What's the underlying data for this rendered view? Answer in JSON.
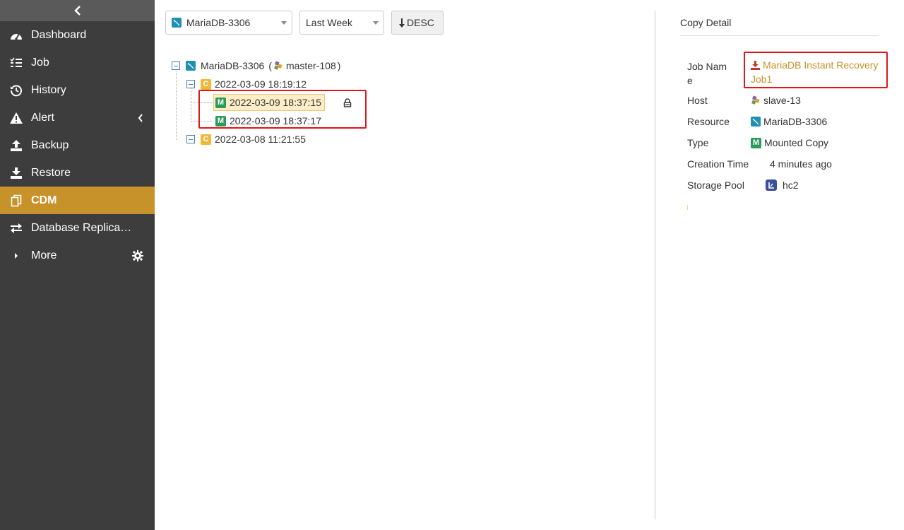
{
  "sidebar": {
    "collapse_icon": "chevron-left-icon",
    "items": [
      {
        "label": "Dashboard",
        "icon": "dashboard-icon"
      },
      {
        "label": "Job",
        "icon": "list-icon"
      },
      {
        "label": "History",
        "icon": "history-icon"
      },
      {
        "label": "Alert",
        "icon": "warning-icon"
      },
      {
        "label": "Backup",
        "icon": "upload-icon"
      },
      {
        "label": "Restore",
        "icon": "download-icon"
      },
      {
        "label": "CDM",
        "icon": "copy-icon"
      },
      {
        "label": "Database Replica…",
        "icon": "exchange-icon"
      },
      {
        "label": "More",
        "icon": "caret-right-icon"
      }
    ],
    "active": "CDM",
    "accent": "#c8922a"
  },
  "toolbar": {
    "resource_select": "MariaDB-3306",
    "range_select": "Last Week",
    "sort_label": "DESC"
  },
  "tree": {
    "root_label": "MariaDB-3306",
    "root_host_open": "(",
    "root_host": "master-108",
    "root_host_close": ")",
    "nodes": [
      {
        "badge": "C",
        "label": "2022-03-09 18:19:12"
      },
      {
        "badge": "M",
        "label": "2022-03-09 18:37:15"
      },
      {
        "badge": "M",
        "label": "2022-03-09 18:37:17"
      },
      {
        "badge": "C",
        "label": "2022-03-08 11:21:55"
      }
    ]
  },
  "detail": {
    "title": "Copy Detail",
    "job_name_label_1": "Job Nam",
    "job_name_label_2": "e",
    "job_name_line_1": "MariaDB Instant Recovery",
    "job_name_line_2": "Job1",
    "host_label": "Host",
    "host_value": "slave-13",
    "resource_label": "Resource",
    "resource_value": "MariaDB-3306",
    "type_label": "Type",
    "type_badge": "M",
    "type_value": "Mounted Copy",
    "creation_label": "Creation Time",
    "creation_value": "4 minutes ago",
    "pool_label": "Storage Pool",
    "pool_value": "hc2"
  }
}
